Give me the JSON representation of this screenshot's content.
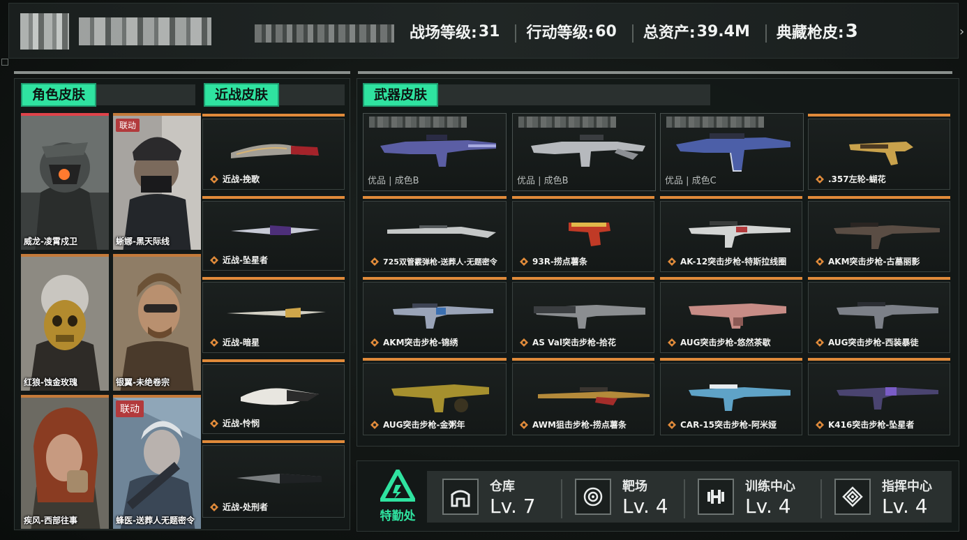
{
  "header": {
    "stats": [
      {
        "label": "战场等级:",
        "value": "31"
      },
      {
        "label": "行动等级: ",
        "value": "60"
      },
      {
        "label": "总资产:",
        "value": "39.4M"
      },
      {
        "label": "典藏枪皮:",
        "value": "3"
      }
    ],
    "arrow": "›"
  },
  "sections": {
    "characters": "角色皮肤",
    "melee": "近战皮肤",
    "weapons": "武器皮肤"
  },
  "characters": [
    {
      "name": "威龙-凌霄戍卫"
    },
    {
      "name": "蜥娜-黑天际线",
      "badge": "联动"
    },
    {
      "name": "红狼-蚀金玫瑰"
    },
    {
      "name": "银翼-未绝卷宗"
    },
    {
      "name": "疾风-西部往事"
    },
    {
      "name": "蜂医-送葬人无题密令",
      "badge": "联动"
    }
  ],
  "melee": [
    {
      "name": "近战-挽歌"
    },
    {
      "name": "近战-坠星者"
    },
    {
      "name": "近战-暗星"
    },
    {
      "name": "近战-怜悯"
    },
    {
      "name": "近战-处刑者"
    }
  ],
  "weapons_featured": [
    {
      "grade": "优品 | 成色B"
    },
    {
      "grade": "优品 | 成色B"
    },
    {
      "grade": "优品 | 成色C"
    }
  ],
  "weapons": [
    {
      "name": ".357左轮-蝴花"
    },
    {
      "name": "725双管霰弹枪-送葬人·无题密令"
    },
    {
      "name": "93R-捞点薯条"
    },
    {
      "name": "AK-12突击步枪-特斯拉线圈"
    },
    {
      "name": "AKM突击步枪-古墓丽影"
    },
    {
      "name": "AKM突击步枪-锦绣"
    },
    {
      "name": "AS Val突击步枪-拾花"
    },
    {
      "name": "AUG突击步枪-悠然茶歇"
    },
    {
      "name": "AUG突击步枪-西装暴徒"
    },
    {
      "name": "AUG突击步枪-金粥年"
    },
    {
      "name": "AWM狙击步枪-捞点薯条"
    },
    {
      "name": "CAR-15突击步枪-阿米娅"
    },
    {
      "name": "K416突击步枪-坠星者"
    }
  ],
  "footer": {
    "quarters_label": "特勤处",
    "facilities": [
      {
        "name": "仓库",
        "level": "Lv. 7",
        "icon": "warehouse-icon"
      },
      {
        "name": "靶场",
        "level": "Lv. 4",
        "icon": "target-icon"
      },
      {
        "name": "训练中心",
        "level": "Lv. 4",
        "icon": "dumbbell-icon"
      },
      {
        "name": "指挥中心",
        "level": "Lv. 4",
        "icon": "command-emblem-icon"
      }
    ]
  },
  "colors": {
    "accent": "#2fe3a0",
    "card_strip": "#e08a3a",
    "char_strip_red": "#e0434a",
    "collab_badge": "#b23a3c"
  }
}
